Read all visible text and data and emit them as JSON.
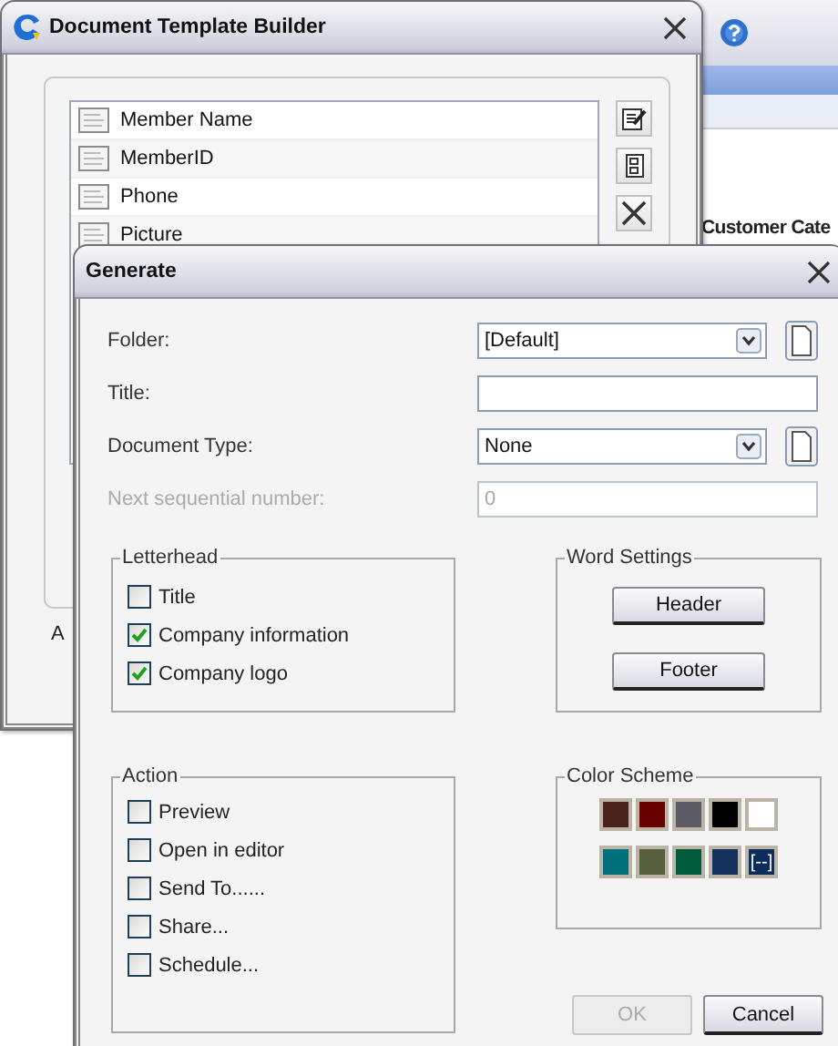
{
  "background_app": {
    "label_1": "Customer Cate"
  },
  "template_builder": {
    "title": "Document Template Builder",
    "fields": [
      {
        "label": "Member Name"
      },
      {
        "label": "MemberID"
      },
      {
        "label": "Phone"
      },
      {
        "label": "Picture"
      }
    ],
    "label_1": "A"
  },
  "generate": {
    "title": "Generate",
    "folder": {
      "label": "Folder:",
      "value": "[Default]"
    },
    "title_field": {
      "label": "Title:"
    },
    "document_type": {
      "label": "Document Type:",
      "value": "None"
    },
    "next_sequential_number": {
      "label": "Next sequential number:",
      "value": "0",
      "disabled": true
    },
    "letterhead": {
      "title": "Letterhead",
      "options": [
        {
          "label": "Title",
          "checked": false
        },
        {
          "label": "Company information",
          "checked": true
        },
        {
          "label": "Company logo",
          "checked": true
        }
      ]
    },
    "word_settings": {
      "title": "Word Settings",
      "buttons": [
        "Header",
        "Footer"
      ]
    },
    "action": {
      "title": "Action",
      "options": [
        {
          "label": "Preview",
          "checked": false
        },
        {
          "label": "Open in editor",
          "checked": false
        },
        {
          "label": "Send To......",
          "checked": false
        },
        {
          "label": "Share...",
          "checked": false
        },
        {
          "label": "Schedule...",
          "checked": false
        }
      ]
    },
    "color_scheme": {
      "title": "Color Scheme",
      "swatches": [
        {
          "color": "#4a221c"
        },
        {
          "color": "#680000"
        },
        {
          "color": "#5c5c66"
        },
        {
          "color": "#000000"
        },
        {
          "color": "#ffffff"
        },
        {
          "color": "#00707a"
        },
        {
          "color": "#56603e"
        },
        {
          "color": "#005a3c"
        },
        {
          "color": "#16305e"
        },
        {
          "color": "#0c2d5c",
          "label": "[--]"
        }
      ]
    },
    "buttons": [
      {
        "label": "OK",
        "disabled": true
      },
      {
        "label": "Cancel",
        "disabled": false
      }
    ]
  }
}
